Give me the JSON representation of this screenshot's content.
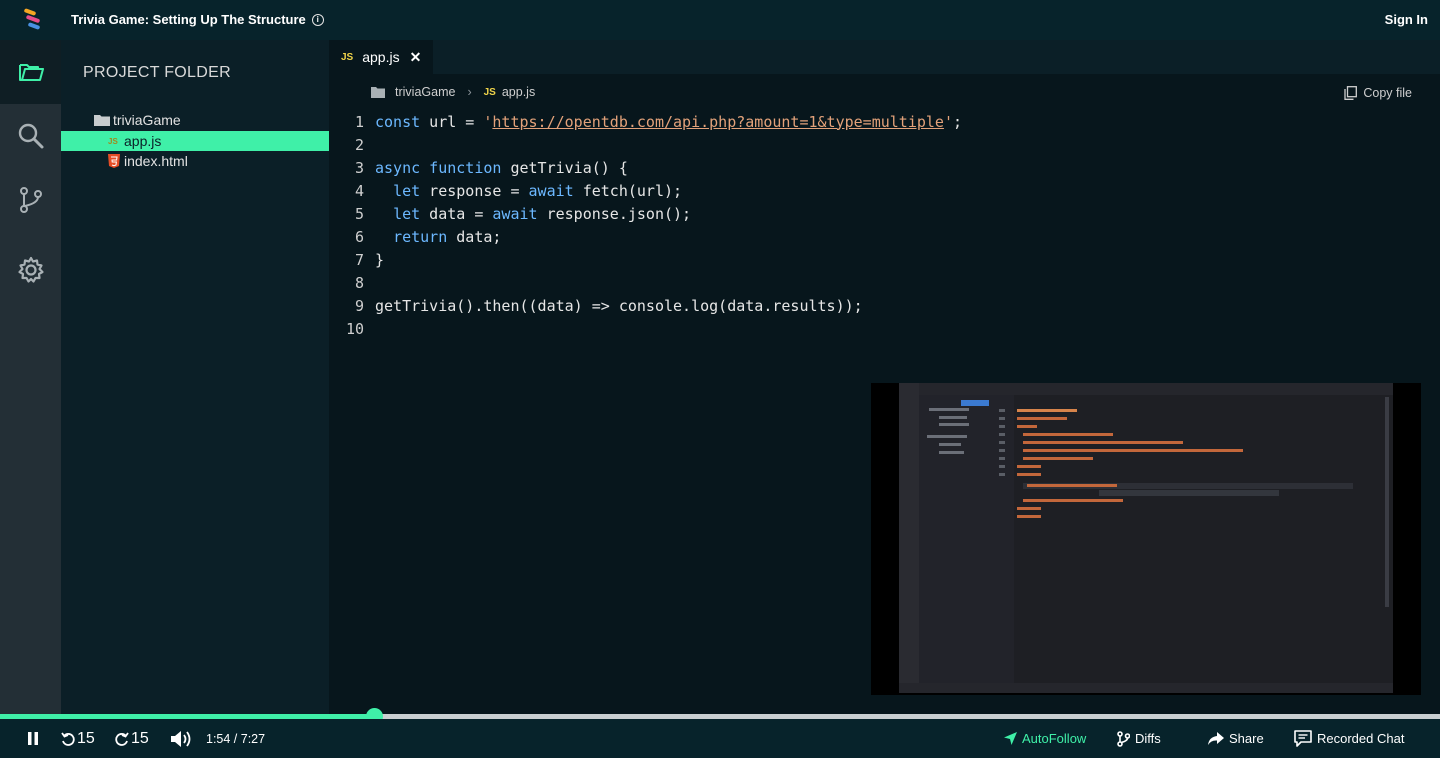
{
  "app": {
    "title": "Trivia Game: Setting Up The Structure",
    "sign_in": "Sign In"
  },
  "sidebar": {
    "icons": [
      "folder-icon",
      "search-icon",
      "git-branch-icon",
      "gear-icon"
    ]
  },
  "project": {
    "heading": "PROJECT FOLDER",
    "folder": "triviaGame",
    "files": [
      {
        "name": "app.js",
        "type": "JS",
        "selected": true
      },
      {
        "name": "index.html",
        "type": "HTML",
        "selected": false
      }
    ]
  },
  "editor": {
    "tab": {
      "badge": "JS",
      "label": "app.js"
    },
    "breadcrumb": {
      "folder": "triviaGame",
      "badge": "JS",
      "file": "app.js"
    },
    "copy_file": "Copy file",
    "line_numbers": [
      "1",
      "2",
      "3",
      "4",
      "5",
      "6",
      "7",
      "8",
      "9",
      "10"
    ]
  },
  "player": {
    "skip_back": "15",
    "skip_forward": "15",
    "time": "1:54 / 7:27",
    "progress": 0.2595,
    "autofollow": "AutoFollow",
    "diffs": "Diffs",
    "share": "Share",
    "recorded_chat": "Recorded Chat"
  },
  "colors": {
    "accent": "#3ff0a8",
    "keyword": "#6cb8ff",
    "string": "#e3a27a",
    "js_badge": "#f0d44a",
    "html_badge": "#e44d26"
  }
}
